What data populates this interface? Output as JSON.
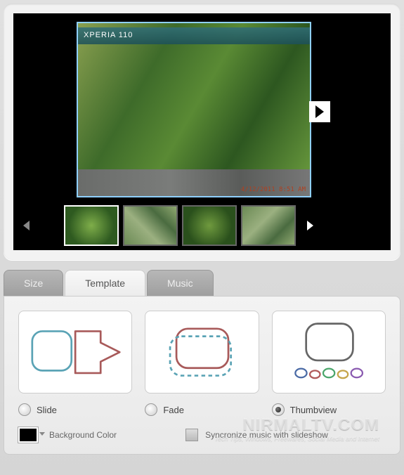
{
  "preview": {
    "photo_label": "XPERIA 110",
    "timestamp": "4/12/2011 8:51 AM",
    "thumbnails": [
      {
        "id": "t1",
        "active": true
      },
      {
        "id": "t2",
        "active": false
      },
      {
        "id": "t3",
        "active": false
      },
      {
        "id": "t4",
        "active": false
      }
    ]
  },
  "tabs": {
    "size": "Size",
    "template": "Template",
    "music": "Music",
    "active": "template"
  },
  "transitions": {
    "slide": "Slide",
    "fade": "Fade",
    "thumbview": "Thumbview",
    "selected": "thumbview"
  },
  "options": {
    "background_color_label": "Background Color",
    "background_color_value": "#000000",
    "sync_label": "Syncronize music with slideshow",
    "sync_checked": false
  },
  "watermark": {
    "title": "NIRMALTV.COM",
    "subtitle": "Tech Tips, Windows, Freewares, Social Media and Internet"
  }
}
